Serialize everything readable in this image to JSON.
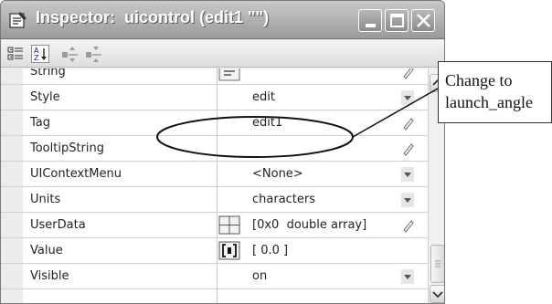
{
  "window": {
    "title": "Inspector:  uicontrol (edit1 \"\")",
    "title_icon": "inspector-window-icon",
    "controls": [
      "minimize-icon",
      "maximize-icon",
      "close-icon"
    ]
  },
  "toolbar": {
    "buttons": [
      "categorize-icon",
      "sort-alphabetical-icon",
      "expand-all-icon",
      "collapse-all-icon"
    ]
  },
  "properties": [
    {
      "name": "String",
      "value": "",
      "button": "text-editor-icon",
      "action": "pencil-icon"
    },
    {
      "name": "Style",
      "value": "edit",
      "action": "dropdown-arrow-icon"
    },
    {
      "name": "Tag",
      "value": "edit1",
      "action": "pencil-icon"
    },
    {
      "name": "TooltipString",
      "value": "",
      "action": "pencil-icon"
    },
    {
      "name": "UIContextMenu",
      "value": "<None>",
      "action": "dropdown-arrow-icon"
    },
    {
      "name": "Units",
      "value": "characters",
      "action": "dropdown-arrow-icon"
    },
    {
      "name": "UserData",
      "value": "[0x0  double array]",
      "button": "array-editor-icon",
      "action": "pencil-icon"
    },
    {
      "name": "Value",
      "value": "[ 0.0 ]",
      "button": "value-editor-icon",
      "action": ""
    },
    {
      "name": "Visible",
      "value": "on",
      "action": "dropdown-arrow-icon"
    }
  ],
  "callout": {
    "line1": "Change to",
    "line2": "launch_angle"
  },
  "colors": {
    "titlebar": "#a9a9a9",
    "grid_line": "#d0d0d0",
    "annotation": "#111111"
  }
}
